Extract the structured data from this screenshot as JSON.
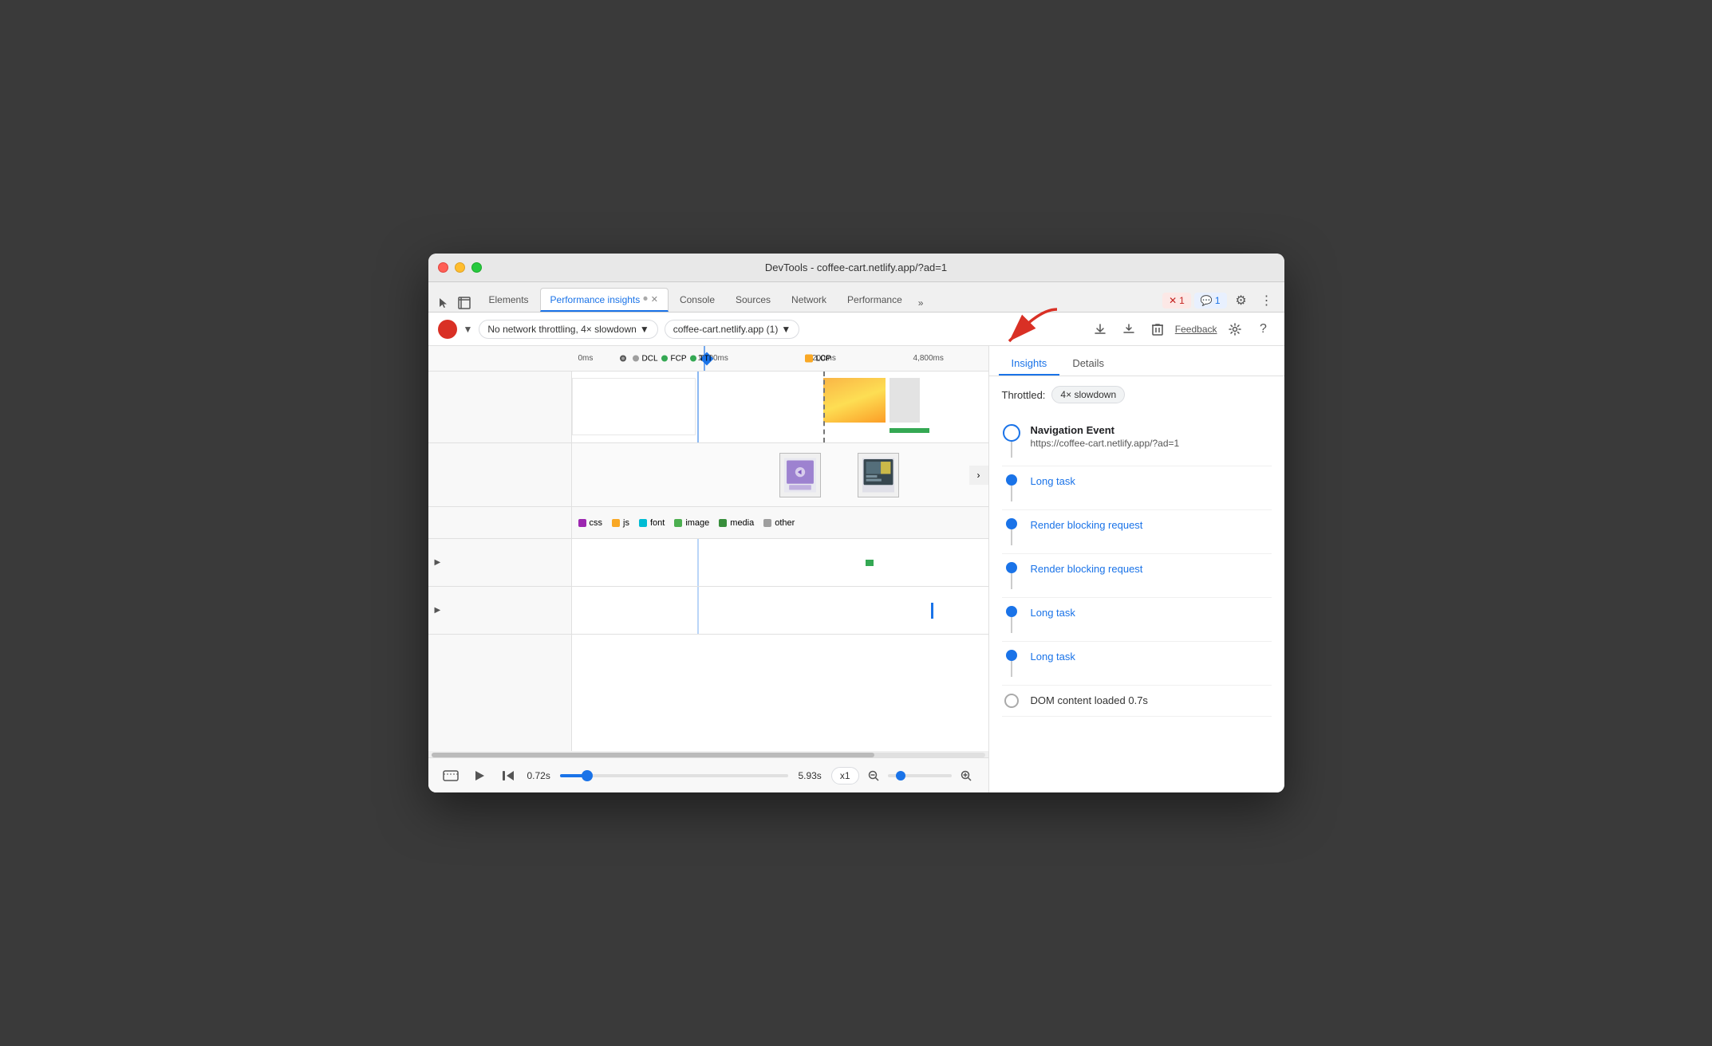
{
  "window": {
    "title": "DevTools - coffee-cart.netlify.app/?ad=1"
  },
  "tabs": [
    {
      "id": "pointer",
      "label": ""
    },
    {
      "id": "elements",
      "label": "Elements"
    },
    {
      "id": "performance-insights",
      "label": "Performance insights",
      "active": true,
      "closable": true
    },
    {
      "id": "console",
      "label": "Console"
    },
    {
      "id": "sources",
      "label": "Sources"
    },
    {
      "id": "network",
      "label": "Network"
    },
    {
      "id": "performance",
      "label": "Performance"
    },
    {
      "id": "more",
      "label": "»"
    }
  ],
  "toolbar": {
    "throttling_label": "No network throttling, 4× slowdown",
    "url_label": "coffee-cart.netlify.app (1)",
    "feedback_label": "Feedback"
  },
  "timeline": {
    "ruler_marks": [
      "0ms",
      "1,600ms",
      "3,200ms",
      "4,800ms"
    ],
    "milestones": [
      "DCL",
      "FCP",
      "TTI",
      "LCP"
    ],
    "milestone_colors": [
      "#aaa",
      "#34a853",
      "#34a853",
      "#f9a825"
    ]
  },
  "legend": {
    "items": [
      {
        "label": "css",
        "color": "#9c27b0"
      },
      {
        "label": "js",
        "color": "#f9a825"
      },
      {
        "label": "font",
        "color": "#00bcd4"
      },
      {
        "label": "image",
        "color": "#4caf50"
      },
      {
        "label": "media",
        "color": "#388e3c"
      },
      {
        "label": "other",
        "color": "#9e9e9e"
      }
    ]
  },
  "right_panel": {
    "tabs": [
      {
        "id": "insights",
        "label": "Insights",
        "active": true
      },
      {
        "id": "details",
        "label": "Details"
      }
    ],
    "throttle_label": "Throttled:",
    "throttle_value": "4× slowdown",
    "insights": [
      {
        "id": "nav-event",
        "title": "Navigation Event",
        "url": "https://coffee-cart.netlify.app/?ad=1",
        "type": "circle-outline-large"
      },
      {
        "id": "long-task-1",
        "title": "Long task",
        "type": "circle-filled",
        "link": true
      },
      {
        "id": "render-blocking-1",
        "title": "Render blocking request",
        "type": "circle-filled",
        "link": true
      },
      {
        "id": "render-blocking-2",
        "title": "Render blocking request",
        "type": "circle-filled",
        "link": true
      },
      {
        "id": "long-task-2",
        "title": "Long task",
        "type": "circle-filled",
        "link": true
      },
      {
        "id": "long-task-3",
        "title": "Long task",
        "type": "circle-filled",
        "link": true
      },
      {
        "id": "dom-content",
        "title": "DOM content loaded 0.7s",
        "type": "circle-outline"
      }
    ]
  },
  "bottom_bar": {
    "time_start": "0.72s",
    "time_end": "5.93s",
    "zoom_level": "x1"
  },
  "badges": {
    "error_count": "1",
    "message_count": "1"
  }
}
